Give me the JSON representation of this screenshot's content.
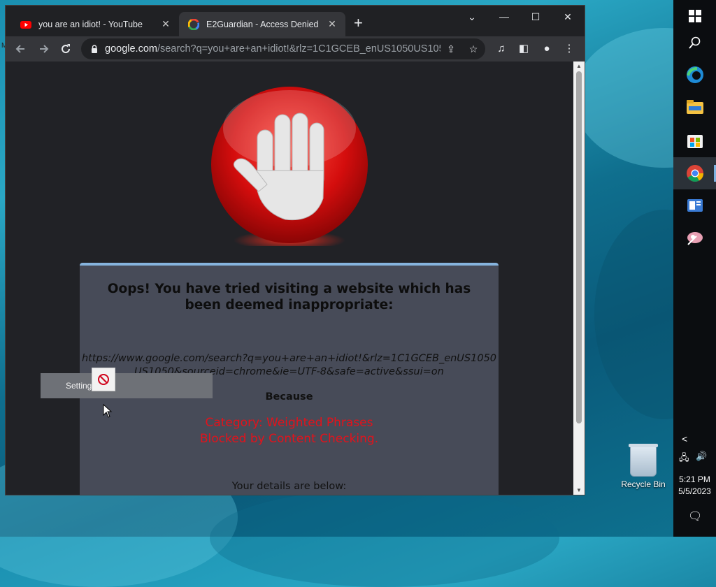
{
  "browser": {
    "tabs": [
      {
        "title": "you are an idiot! - YouTube",
        "active": false,
        "favicon": "youtube-icon"
      },
      {
        "title": "E2Guardian - Access Denied",
        "active": true,
        "favicon": "google-icon"
      }
    ],
    "new_tab": "+",
    "url_domain": "google.com",
    "url_rest": "/search?q=you+are+an+idiot!&rlz=1C1GCEB_enUS1050US105...",
    "window_controls": {
      "dropdown": "⌄",
      "minimize": "—",
      "maximize": "☐",
      "close": "✕"
    }
  },
  "page": {
    "headline": "Oops! You have tried visiting a website which has been deemed inappropriate:",
    "blocked_url": "https://www.google.com/search?q=you+are+an+idiot!&rlz=1C1GCEB_enUS1050US1050&sourceid=chrome&ie=UTF-8&safe=active&ssui=on",
    "because": "Because",
    "reason_line1": "Category: Weighted Phrases",
    "reason_line2": "Blocked by Content Checking.",
    "more_text": "Your details are below:"
  },
  "overlay": {
    "label": "Settings"
  },
  "desktop": {
    "recycle_bin": "Recycle Bin",
    "edge_letter": "M"
  },
  "taskbar": {
    "time": "5:21 PM",
    "date": "5/5/2023",
    "icons": [
      "windows-start-icon",
      "search-icon",
      "edge-icon",
      "file-explorer-icon",
      "store-icon",
      "chrome-icon",
      "news-icon",
      "snipping-tool-icon"
    ]
  },
  "colors": {
    "reason": "#e3121b",
    "panel": "#474b58",
    "accent_bar": "#86b4de"
  }
}
